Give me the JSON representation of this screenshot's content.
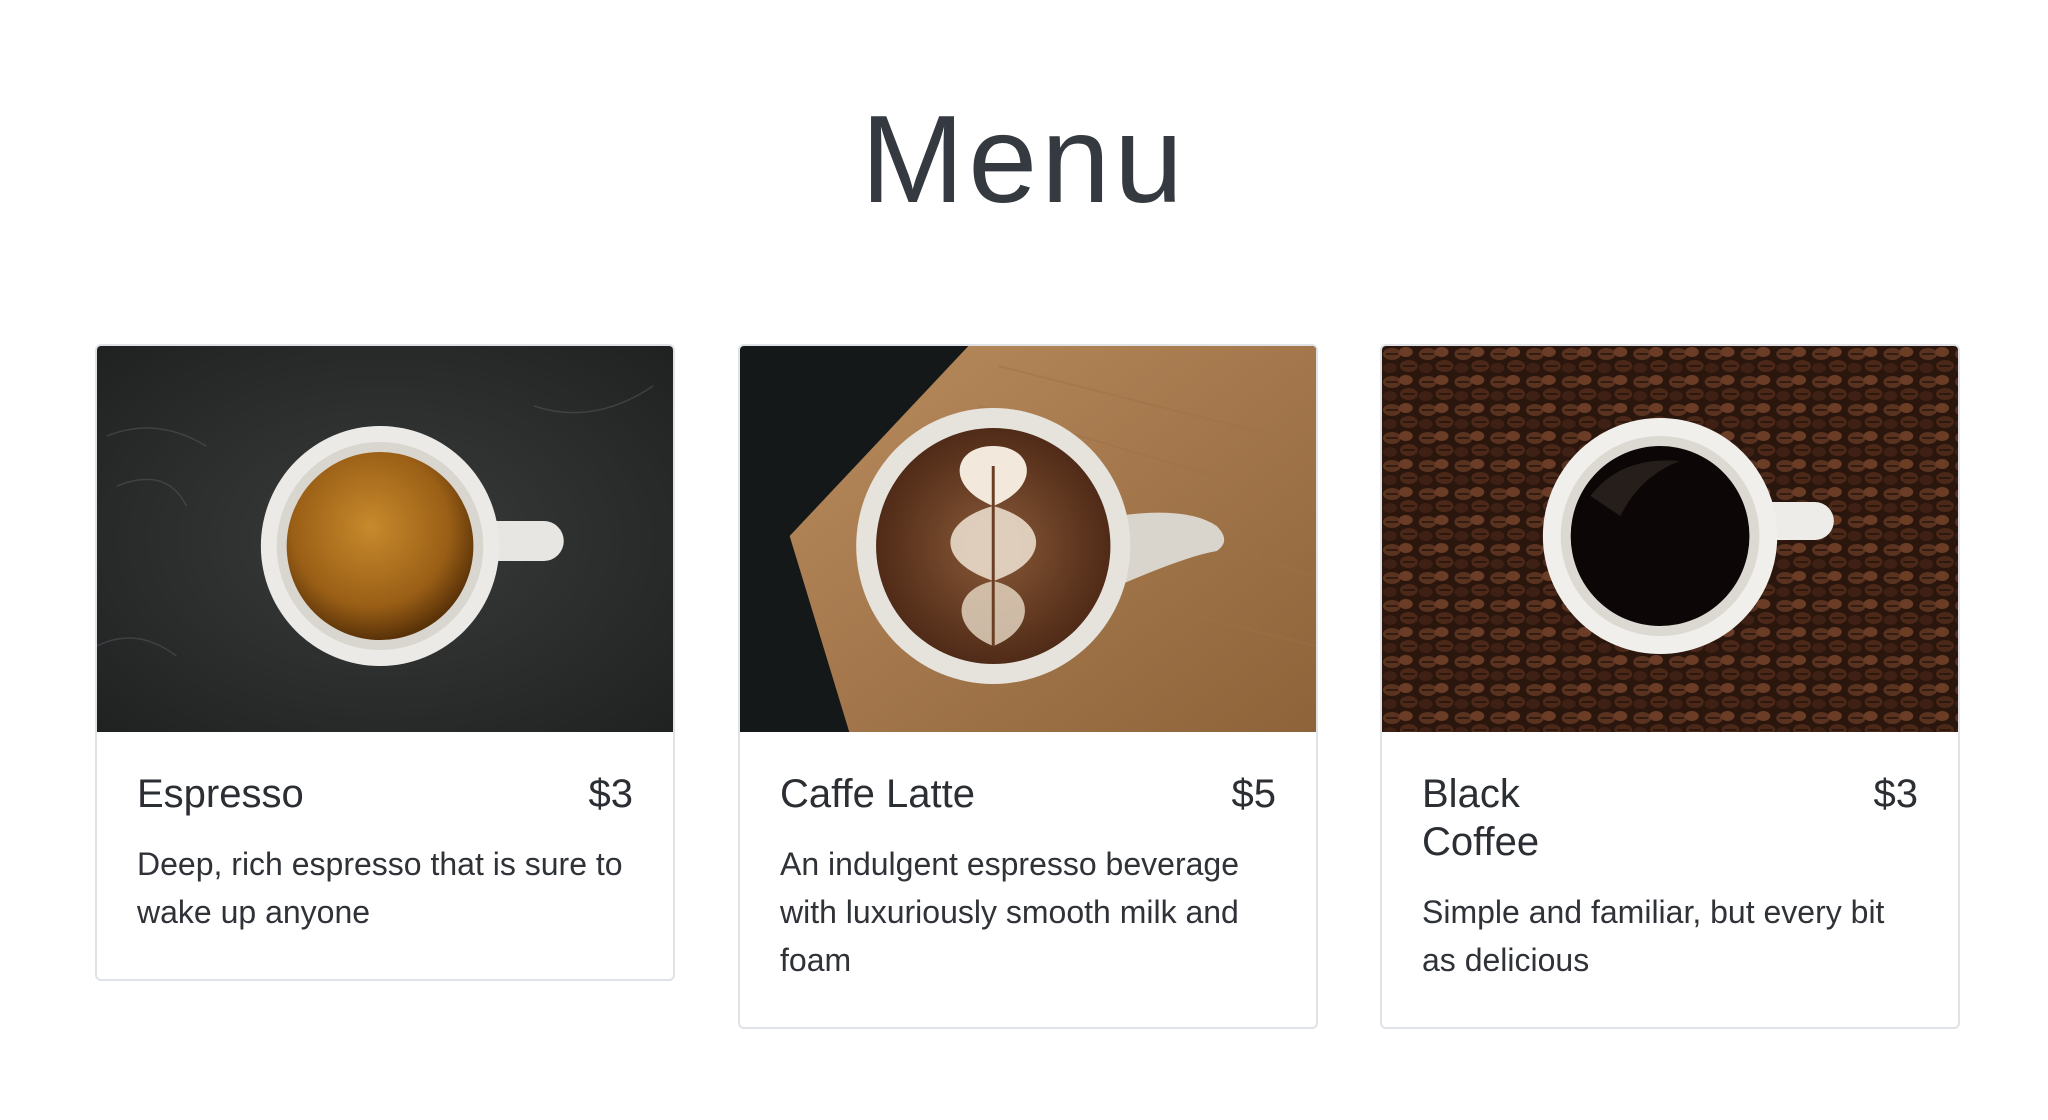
{
  "page": {
    "title": "Menu"
  },
  "items": [
    {
      "name": "Espresso",
      "price": "$3",
      "description": "Deep, rich espresso that is sure to wake up anyone",
      "image": "espresso-cup-photo"
    },
    {
      "name": "Caffe Latte",
      "price": "$5",
      "description": "An indulgent espresso beverage with luxuriously smooth milk and foam",
      "image": "latte-art-cup-photo"
    },
    {
      "name": "Black Coffee",
      "price": "$3",
      "description": "Simple and familiar, but every bit as delicious",
      "image": "black-coffee-on-beans-photo"
    }
  ],
  "colors": {
    "title": "#343a40",
    "card_border": "#dfe2e6",
    "text": "#2b2e33"
  }
}
